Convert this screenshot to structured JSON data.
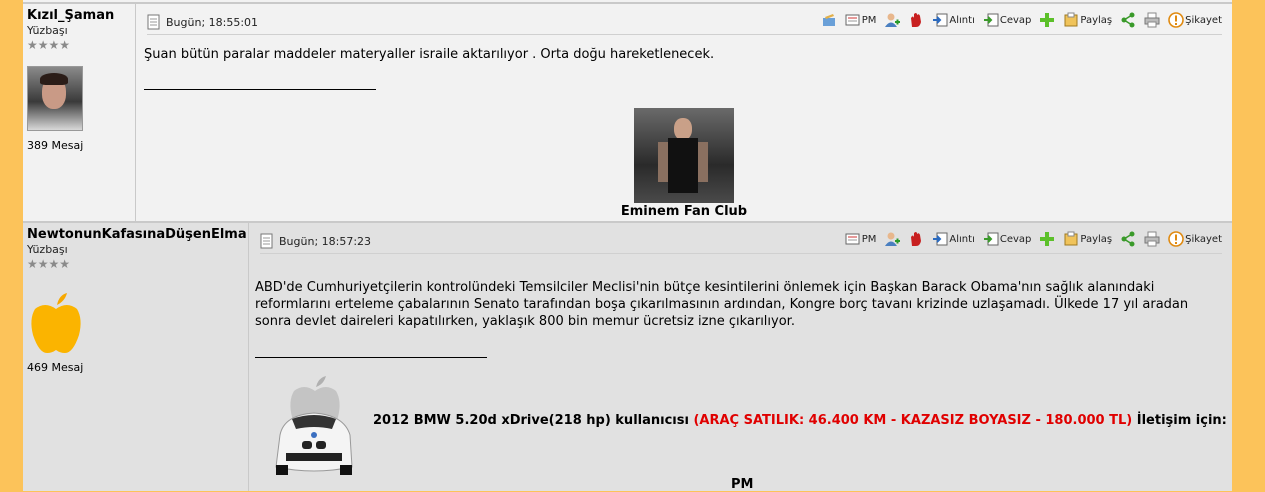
{
  "posts": [
    {
      "author": {
        "name": "Kızıl_Şaman",
        "rank": "Yüzbaşı",
        "stars": "★★★★",
        "message_count": "389 Mesaj"
      },
      "date": "Bugün; 18:55:01",
      "actions": {
        "pm": "PM",
        "quote": "Alıntı",
        "reply": "Cevap",
        "share": "Paylaş",
        "report": "Şikayet"
      },
      "text": "Şuan bütün paralar maddeler materyaller israile aktarılıyor . Orta doğu hareketlenecek.",
      "signature": {
        "caption": "Eminem Fan Club"
      }
    },
    {
      "author": {
        "name": "NewtonunKafasınaDüşenElma",
        "rank": "Yüzbaşı",
        "stars": "★★★★",
        "message_count": "469 Mesaj"
      },
      "date": "Bugün; 18:57:23",
      "actions": {
        "pm": "PM",
        "quote": "Alıntı",
        "reply": "Cevap",
        "share": "Paylaş",
        "report": "Şikayet"
      },
      "text": "ABD'de Cumhuriyetçilerin kontrolündeki Temsilciler Meclisi'nin bütçe kesintilerini önlemek için Başkan Barack Obama'nın sağlık alanındaki reformlarını erteleme çabalarının Senato tarafından boşa çıkarılmasının ardından, Kongre borç tavanı krizinde uzlaşamadı. Ülkede 17 yıl aradan sonra devlet daireleri kapatılırken, yaklaşık 800 bin memur ücretsiz izne çıkarılıyor.",
      "signature": {
        "car": "2012 BMW 5.20d xDrive(218 hp) kullanıcısı",
        "sale": "(ARAÇ SATILIK: 46.400 KM - KAZASIZ BOYASIZ - 180.000 TL)",
        "contact": "İletişim için:",
        "pm": "PM"
      }
    }
  ],
  "colors": {
    "page_bg": "#fcc35a",
    "post1_bg": "#f2f2f2",
    "post2_bg": "#e1e1e1",
    "sale_red": "#e00000"
  }
}
